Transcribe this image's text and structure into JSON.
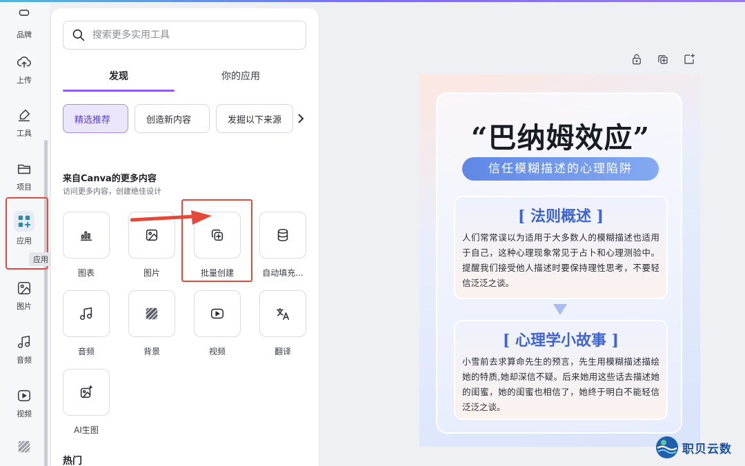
{
  "rail": {
    "items": [
      {
        "label": "品牌",
        "icon": "brand-icon"
      },
      {
        "label": "上传",
        "icon": "upload-cloud-icon"
      },
      {
        "label": "工具",
        "icon": "pen-tool-icon"
      },
      {
        "label": "项目",
        "icon": "folder-icon"
      },
      {
        "label": "应用",
        "icon": "apps-grid-icon"
      },
      {
        "label": "图片",
        "icon": "image-icon"
      },
      {
        "label": "音频",
        "icon": "music-note-icon"
      },
      {
        "label": "视频",
        "icon": "video-play-icon"
      }
    ],
    "tooltip": "应用"
  },
  "panel": {
    "search_placeholder": "搜索更多实用工具",
    "tabs": [
      "发现",
      "你的应用"
    ],
    "chips": [
      "精选推荐",
      "创造新内容",
      "发掘以下来源"
    ],
    "section_title": "来自Canva的更多内容",
    "section_subtitle": "访问更多内容，创建绝佳设计",
    "apps": [
      {
        "label": "图表",
        "icon": "chart-bars-icon"
      },
      {
        "label": "图片",
        "icon": "image-icon"
      },
      {
        "label": "批量创建",
        "icon": "bulk-create-icon"
      },
      {
        "label": "自动填充...",
        "icon": "database-icon"
      },
      {
        "label": "音频",
        "icon": "music-note-icon"
      },
      {
        "label": "背景",
        "icon": "background-pattern-icon"
      },
      {
        "label": "视频",
        "icon": "video-play-icon"
      },
      {
        "label": "翻译",
        "icon": "translate-icon"
      },
      {
        "label": "AI生图",
        "icon": "ai-image-icon"
      }
    ],
    "hot_label": "热门"
  },
  "annotation": {
    "color": "#e2493b"
  },
  "toolbar_icons": [
    "lock-icon",
    "duplicate-icon",
    "add-page-icon"
  ],
  "poster": {
    "title": "“巴纳姆效应”",
    "subtitle": "信任模糊描述的心理陷阱",
    "card1_title": "[ 法则概述 ]",
    "card1_text": "人们常常误以为适用于大多数人的模糊描述也适用于自己，这种心理现象常见于占卜和心理测验中。提醒我们接受他人描述时要保持理性思考，不要轻信泛泛之谈。",
    "card2_title": "[ 心理学小故事 ]",
    "card2_text": "小雪前去求算命先生的预言，先生用模糊描述描绘她的特质,她却深信不疑。后来她用这些话去描述她的闺蜜，她的闺蜜也相信了，她终于明白不能轻信泛泛之谈。"
  },
  "watermark": {
    "text": "职贝云数"
  },
  "colors": {
    "accent": "#8b5cf6",
    "poster_blue": "#3f64cf"
  }
}
